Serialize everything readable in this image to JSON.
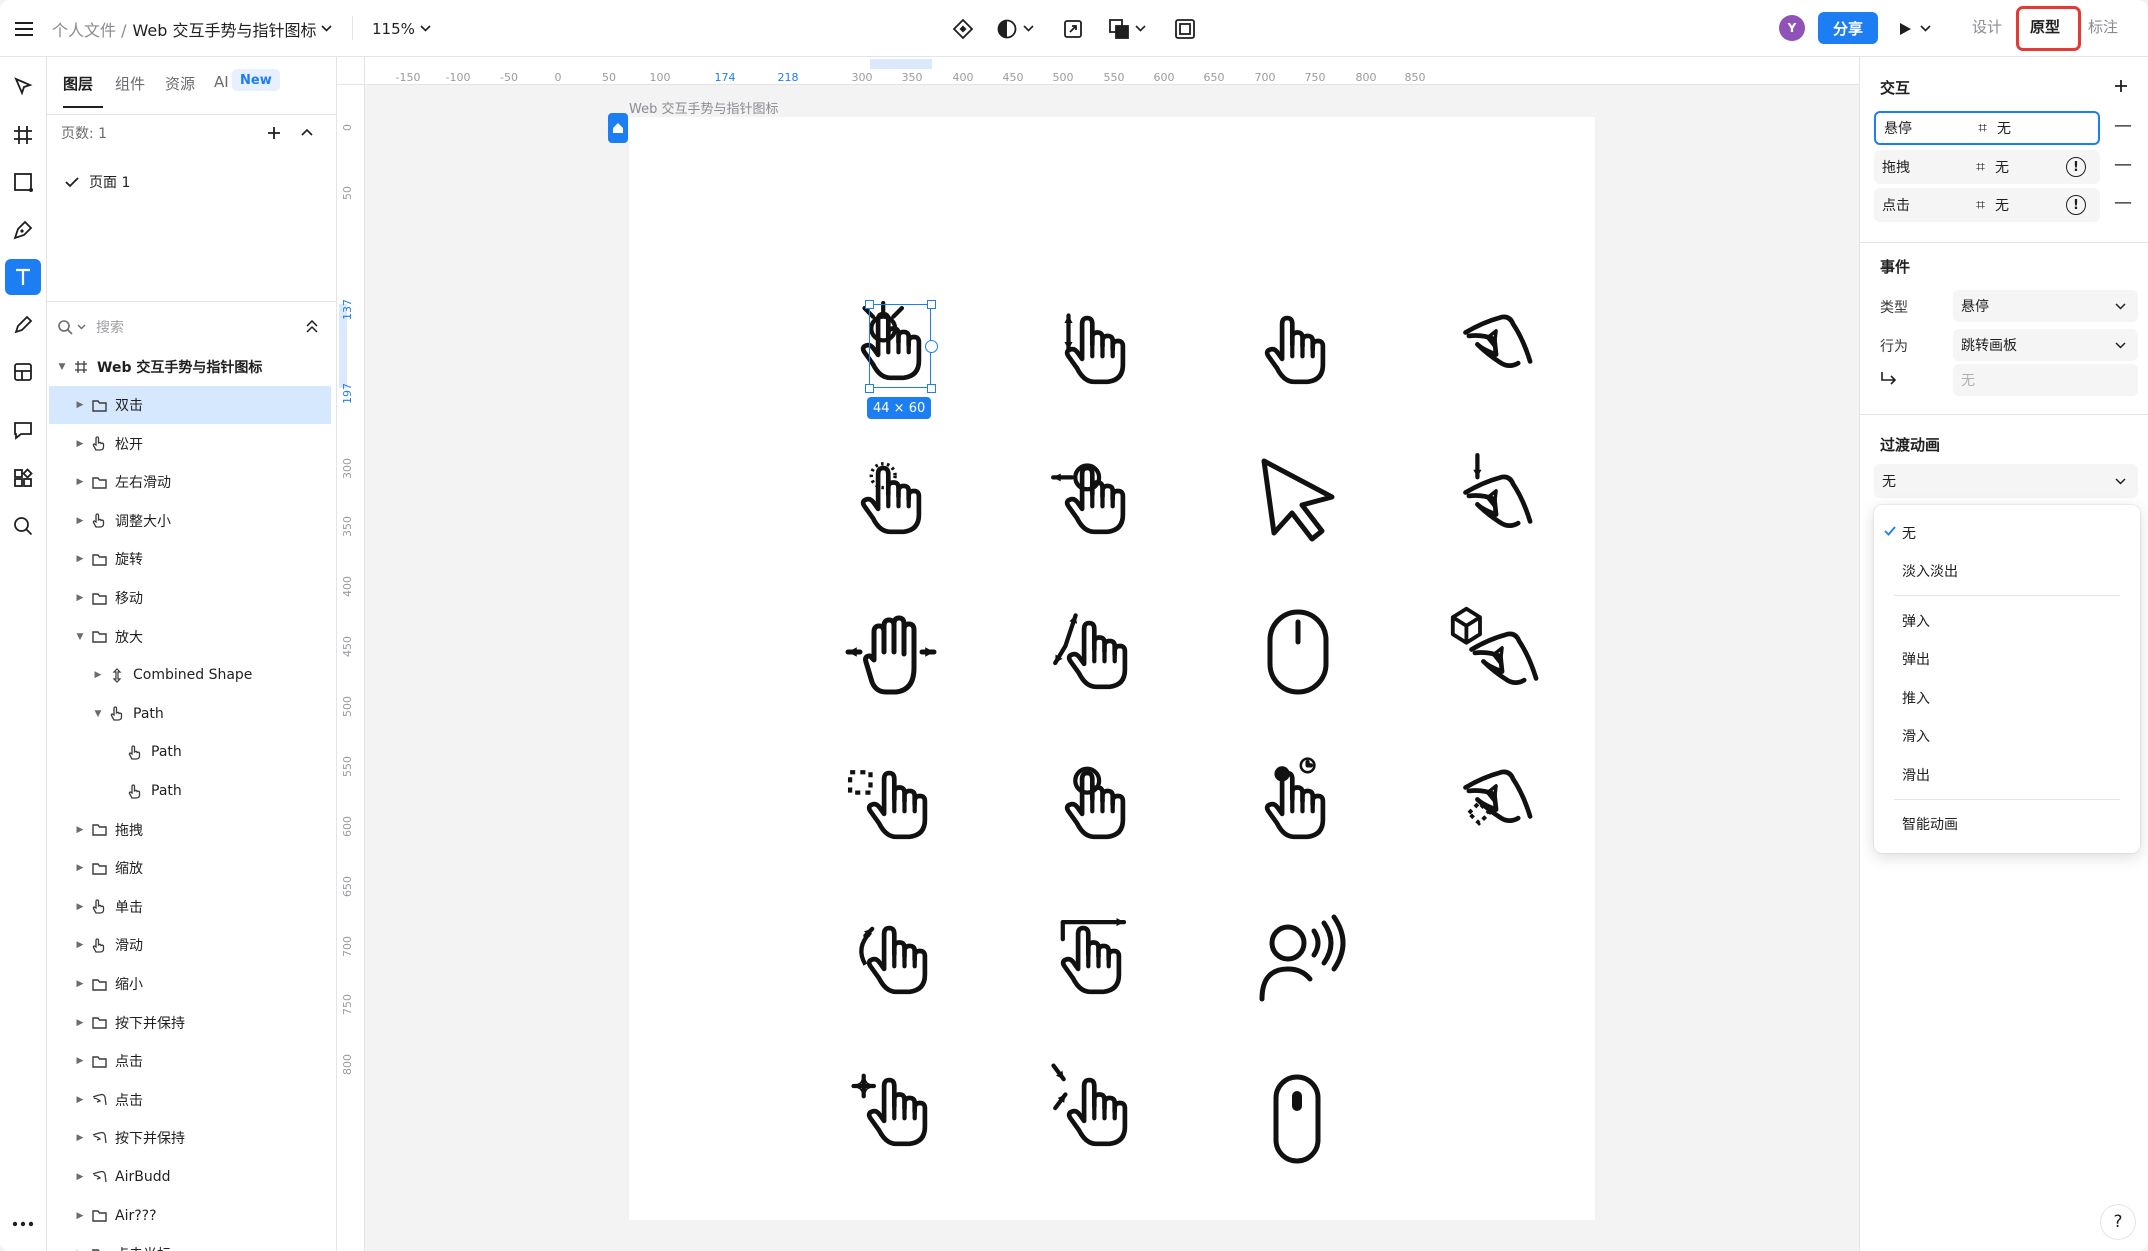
{
  "topbar": {
    "breadcrumb": "个人文件 /",
    "doc_title": "Web 交互手势与指针图标",
    "zoom": "115%",
    "avatar_initial": "Y",
    "share": "分享",
    "tab_design": "设计",
    "tab_prototype": "原型",
    "tab_annotate": "标注"
  },
  "layers": {
    "tabs": [
      "图层",
      "组件",
      "资源",
      "AI"
    ],
    "new_badge": "New",
    "pages_count": "页数: 1",
    "page_name": "页面 1",
    "search_placeholder": "搜索",
    "root": "Web 交互手势与指针图标",
    "items": [
      "双击",
      "松开",
      "左右滑动",
      "调整大小",
      "旋转",
      "移动",
      "放大",
      "Combined Shape",
      "Path",
      "Path",
      "Path",
      "拖拽",
      "缩放",
      "单击",
      "滑动",
      "缩小",
      "按下并保持",
      "点击",
      "点击",
      "按下并保持",
      "AirBudd",
      "Air???",
      "点击光标"
    ]
  },
  "canvas": {
    "artboard_title": "Web 交互手势与指针图标",
    "size_label": "44 × 60",
    "hruler": [
      "-150",
      "-100",
      "-50",
      "0",
      "50",
      "100",
      "174",
      "218",
      "300",
      "350",
      "400",
      "450",
      "500",
      "550",
      "600",
      "650",
      "700",
      "750",
      "800",
      "850"
    ],
    "vruler": [
      "0",
      "50",
      "137",
      "197",
      "300",
      "350",
      "400",
      "450",
      "500",
      "550",
      "600",
      "650",
      "700",
      "750",
      "800"
    ]
  },
  "right": {
    "interaction_title": "交互",
    "interactions": [
      {
        "trigger": "悬停",
        "target": "无"
      },
      {
        "trigger": "拖拽",
        "target": "无"
      },
      {
        "trigger": "点击",
        "target": "无"
      }
    ],
    "event_title": "事件",
    "type_label": "类型",
    "type_value": "悬停",
    "action_label": "行为",
    "action_value": "跳转画板",
    "dest_placeholder": "无",
    "transition_title": "过渡动画",
    "transition_value": "无",
    "options": [
      "无",
      "淡入淡出",
      "弹入",
      "弹出",
      "推入",
      "滑入",
      "滑出",
      "智能动画"
    ],
    "help": "?"
  },
  "colors": {
    "accent": "#1d7df2",
    "highlight_box": "#e53935",
    "avatar": "#8e52b8"
  }
}
